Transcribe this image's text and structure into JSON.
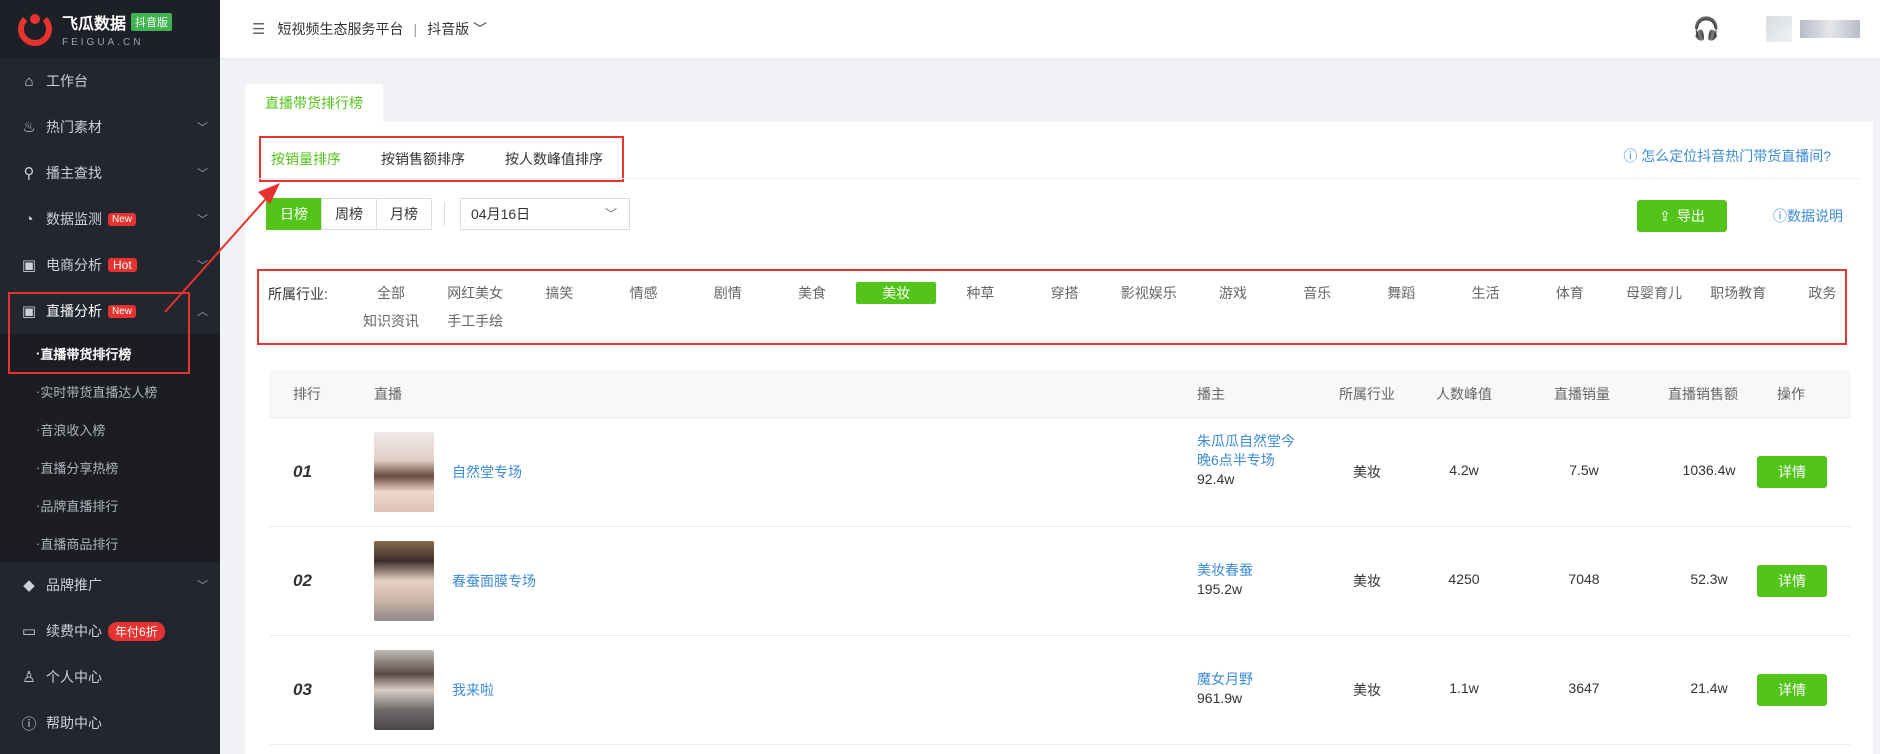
{
  "brand": {
    "name": "飞瓜数据",
    "badge": "抖音版",
    "domain": "FEIGUA.CN",
    "accent": "#e6332f"
  },
  "sidebar": {
    "items": [
      {
        "label": "工作台",
        "icon": "home-icon"
      },
      {
        "label": "热门素材",
        "icon": "fire-icon",
        "expandable": true
      },
      {
        "label": "播主查找",
        "icon": "search-icon",
        "expandable": true
      },
      {
        "label": "数据监测",
        "icon": "monitor-icon",
        "tag": "New",
        "expandable": true
      },
      {
        "label": "电商分析",
        "icon": "shop-bag-icon",
        "tag": "Hot",
        "expandable": true
      },
      {
        "label": "直播分析",
        "icon": "live-bag-icon",
        "tag": "New",
        "expandable": true,
        "expanded": true
      },
      {
        "label": "品牌推广",
        "icon": "diamond-icon",
        "expandable": true
      },
      {
        "label": "续费中心",
        "icon": "card-icon",
        "tag": "年付6折"
      },
      {
        "label": "个人中心",
        "icon": "user-icon"
      },
      {
        "label": "帮助中心",
        "icon": "help-icon"
      }
    ],
    "live_sub": [
      "直播带货排行榜",
      "实时带货直播达人榜",
      "音浪收入榜",
      "直播分享热榜",
      "品牌直播排行",
      "直播商品排行"
    ]
  },
  "header": {
    "crumb": "短视频生态服务平台",
    "version": "抖音版"
  },
  "page": {
    "tab": "直播带货排行榜",
    "sort_tabs": [
      "按销量排序",
      "按销售额排序",
      "按人数峰值排序"
    ],
    "help_link": "怎么定位抖音热门带货直播间?",
    "periods": [
      "日榜",
      "周榜",
      "月榜"
    ],
    "date": "04月16日",
    "export_label": "导出",
    "data_desc": "数据说明",
    "industry_label": "所属行业:",
    "industries_row1": [
      "全部",
      "网红美女",
      "搞笑",
      "情感",
      "剧情",
      "美食",
      "美妆",
      "种草",
      "穿搭",
      "影视娱乐",
      "游戏",
      "音乐",
      "舞蹈",
      "生活",
      "体育",
      "母婴育儿",
      "职场教育",
      "政务"
    ],
    "industries_row2": [
      "知识资讯",
      "手工手绘"
    ],
    "active_industry": "美妆"
  },
  "table": {
    "headers": [
      "排行",
      "直播",
      "播主",
      "所属行业",
      "人数峰值",
      "直播销量",
      "直播销售额",
      "操作"
    ],
    "rows": [
      {
        "rank": "01",
        "title": "自然堂专场",
        "host": "朱瓜瓜自然堂今晚6点半专场",
        "fans": "92.4w",
        "industry": "美妆",
        "peak": "4.2w",
        "sales": "7.5w",
        "revenue": "1036.4w",
        "action": "详情"
      },
      {
        "rank": "02",
        "title": "春蚕面膜专场",
        "host": "美妆春蚕",
        "fans": "195.2w",
        "industry": "美妆",
        "peak": "4250",
        "sales": "7048",
        "revenue": "52.3w",
        "action": "详情"
      },
      {
        "rank": "03",
        "title": "我来啦",
        "host": "魔女月野",
        "fans": "961.9w",
        "industry": "美妆",
        "peak": "1.1w",
        "sales": "3647",
        "revenue": "21.4w",
        "action": "详情"
      }
    ]
  }
}
